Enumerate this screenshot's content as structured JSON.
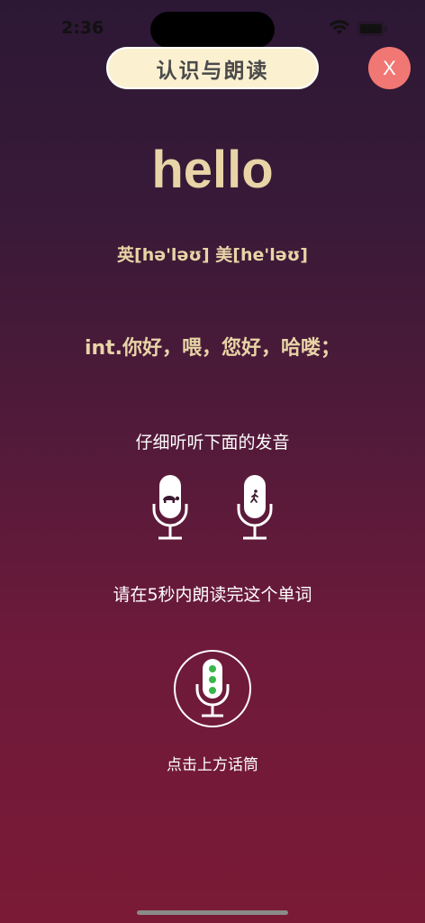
{
  "status": {
    "time": "2:36"
  },
  "header": {
    "title": "认识与朗读",
    "close_label": "X"
  },
  "word": {
    "text": "hello",
    "phonetic": "英[hə'ləʊ] 美[he'ləʊ]",
    "meaning": "int.你好，喂，您好，哈喽；"
  },
  "listen": {
    "instruction": "仔细听听下面的发音",
    "slow_icon": "turtle-mic-icon",
    "normal_icon": "walking-person-mic-icon"
  },
  "record": {
    "instruction": "请在5秒内朗读完这个单词",
    "tap_hint": "点击上方话筒",
    "indicator_color": "#3bb54a"
  },
  "colors": {
    "accent": "#e8d4a6",
    "pill_bg": "#fbf1d1",
    "close_bg": "#f07773"
  }
}
